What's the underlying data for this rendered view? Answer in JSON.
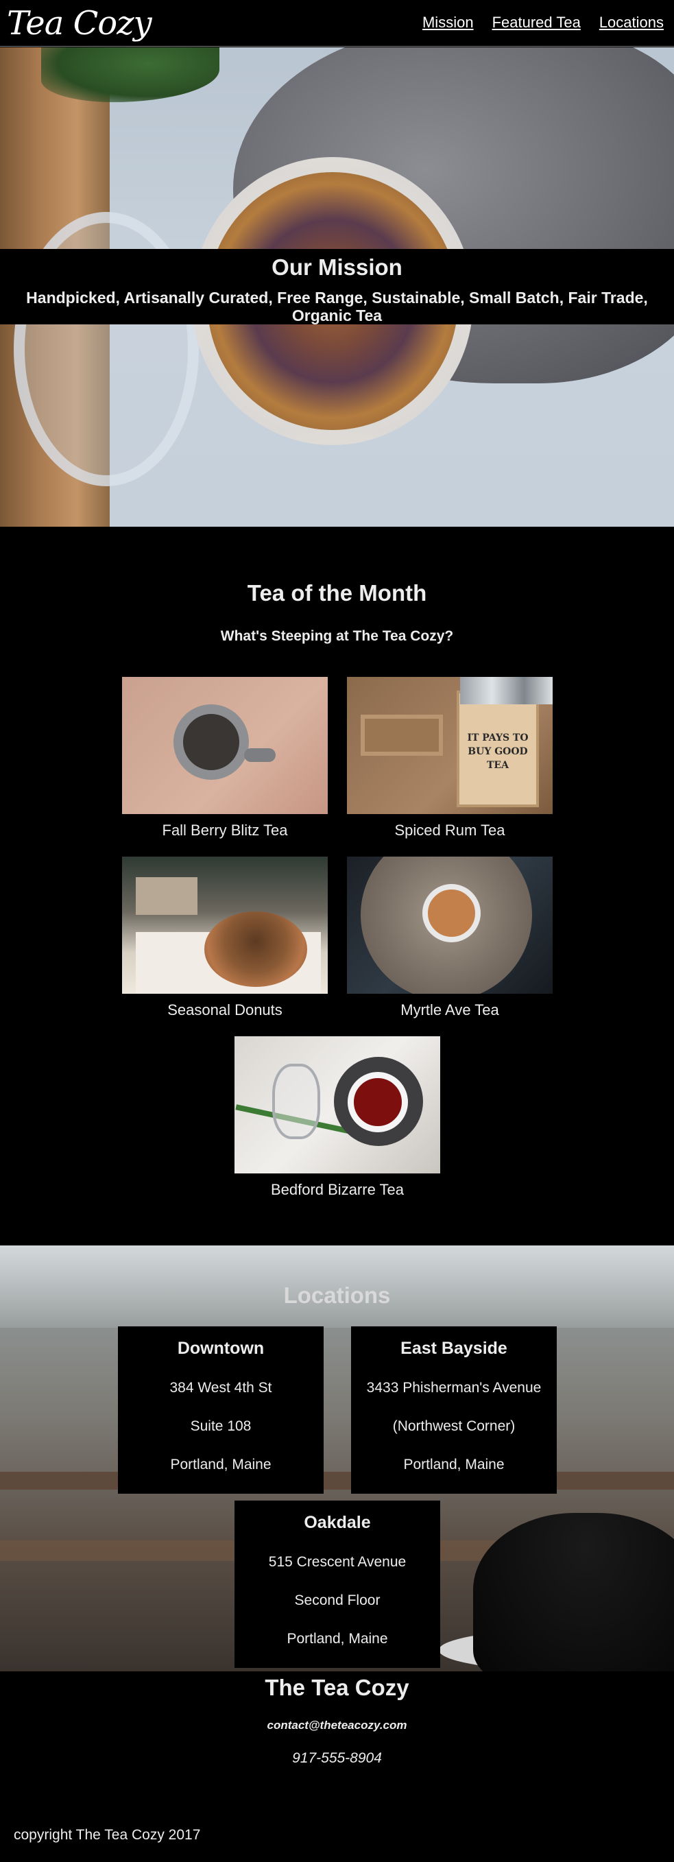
{
  "header": {
    "logo": "Tea Cozy",
    "nav": [
      "Mission",
      "Featured Tea",
      "Locations"
    ]
  },
  "mission": {
    "title": "Our Mission",
    "tagline": "Handpicked, Artisanally Curated, Free Range, Sustainable, Small Batch, Fair Trade, Organic Tea"
  },
  "tea_of_month": {
    "title": "Tea of the Month",
    "subtitle": "What's Steeping at The Tea Cozy?",
    "items": [
      {
        "name": "Fall Berry Blitz Tea"
      },
      {
        "name": "Spiced Rum Tea"
      },
      {
        "name": "Seasonal Donuts"
      },
      {
        "name": "Myrtle Ave Tea"
      },
      {
        "name": "Bedford Bizarre Tea"
      }
    ],
    "rum_sign": "IT PAYS TO BUY GOOD TEA"
  },
  "locations": {
    "title": "Locations",
    "list": [
      {
        "name": "Downtown",
        "line1": "384 West 4th St",
        "line2": "Suite 108",
        "line3": "Portland, Maine"
      },
      {
        "name": "East Bayside",
        "line1": "3433 Phisherman's Avenue",
        "line2": "(Northwest Corner)",
        "line3": "Portland, Maine"
      },
      {
        "name": "Oakdale",
        "line1": "515 Crescent Avenue",
        "line2": "Second Floor",
        "line3": "Portland, Maine"
      }
    ]
  },
  "footer": {
    "title": "The Tea Cozy",
    "email": "contact@theteacozy.com",
    "phone": "917-555-8904",
    "copyright": "copyright The Tea Cozy 2017"
  }
}
